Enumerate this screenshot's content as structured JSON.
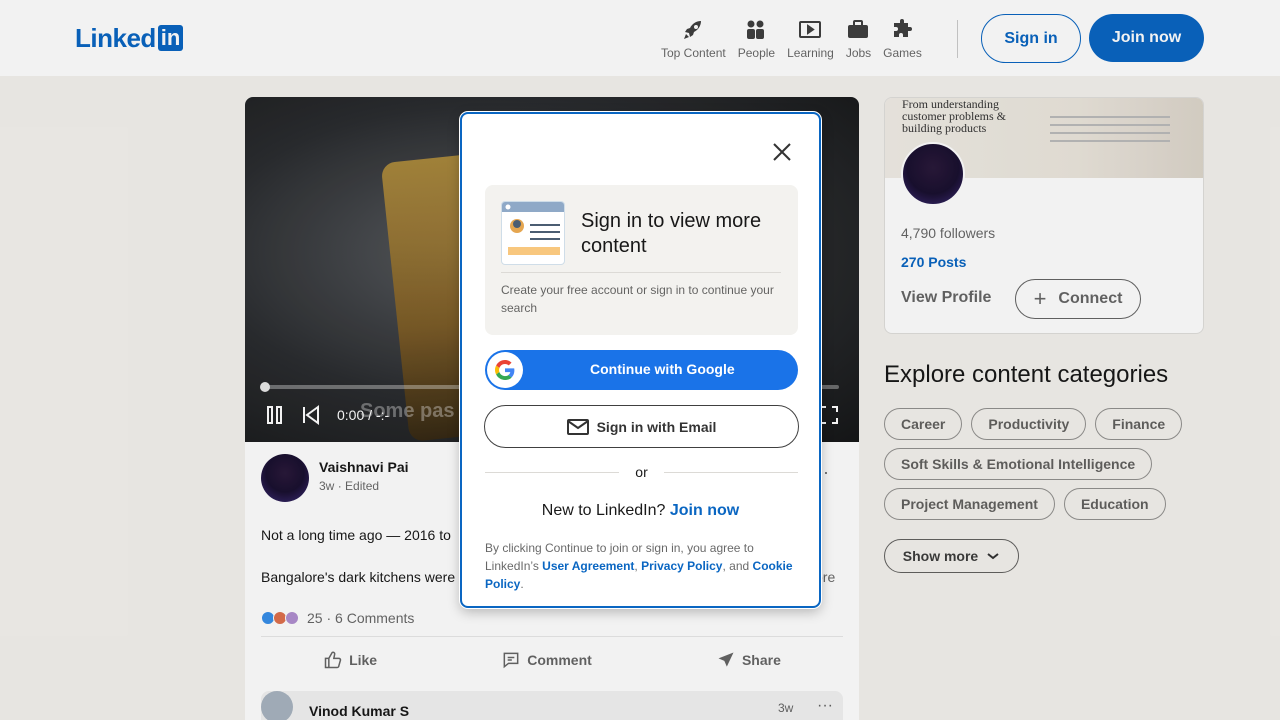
{
  "header": {
    "nav": [
      {
        "label": "Top Content",
        "icon": "rocket-icon"
      },
      {
        "label": "People",
        "icon": "people-icon"
      },
      {
        "label": "Learning",
        "icon": "learning-icon"
      },
      {
        "label": "Jobs",
        "icon": "briefcase-icon"
      },
      {
        "label": "Games",
        "icon": "puzzle-icon"
      }
    ],
    "signin_label": "Sign in",
    "join_label": "Join now",
    "brand_color": "#0a66c2"
  },
  "post": {
    "video": {
      "caption": "Some pas",
      "time": "0:00 / -:-"
    },
    "author": "Vaishnavi Pai",
    "meta_time": "3w",
    "meta_edited": "Edited",
    "text1": "Not a long time ago — 2016 to",
    "text2": "Bangalore's dark kitchens were",
    "see_more": "ore",
    "reaction_count": "25",
    "comments": "6 Comments",
    "actions": {
      "like": "Like",
      "comment": "Comment",
      "share": "Share"
    },
    "comment": {
      "name": "Vinod Kumar S",
      "time": "3w"
    }
  },
  "profile": {
    "banner_text": "From understanding customer problems & building products",
    "followers": "4,790 followers",
    "posts": "270 Posts",
    "view_profile": "View Profile",
    "connect": "Connect"
  },
  "explore": {
    "title": "Explore content categories",
    "pills": [
      "Career",
      "Productivity",
      "Finance",
      "Soft Skills & Emotional Intelligence",
      "Project Management",
      "Education"
    ],
    "show_more": "Show more"
  },
  "modal": {
    "title": "Sign in to view more content",
    "subtitle": "Create your free account or sign in to continue your search",
    "google_label": "Continue with Google",
    "email_label": "Sign in with Email",
    "or": "or",
    "new_to": "New to LinkedIn?",
    "join_now": "Join now",
    "legal_prefix": "By clicking Continue to join or sign in, you agree to LinkedIn’s ",
    "user_agreement": "User Agreement",
    "comma": ", ",
    "privacy_policy": "Privacy Policy",
    "and": ", and",
    "cookie_policy": "Cookie Policy",
    "period": "."
  }
}
